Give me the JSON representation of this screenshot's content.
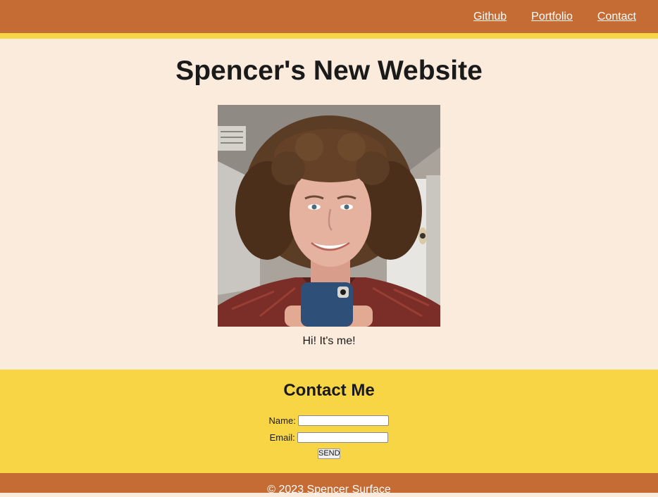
{
  "nav": {
    "links": [
      "Github",
      "Portfolio",
      "Contact"
    ]
  },
  "hero": {
    "title": "Spencer's New Website",
    "caption": "Hi! It's me!"
  },
  "contact": {
    "title": "Contact Me",
    "name_label": "Name:",
    "name_value": "",
    "email_label": "Email:",
    "email_value": "",
    "send_label": "SEND"
  },
  "footer": {
    "text": "© 2023 Spencer Surface"
  },
  "colors": {
    "header": "#c46c34",
    "accent": "#f8d545",
    "background": "#faebdc"
  }
}
